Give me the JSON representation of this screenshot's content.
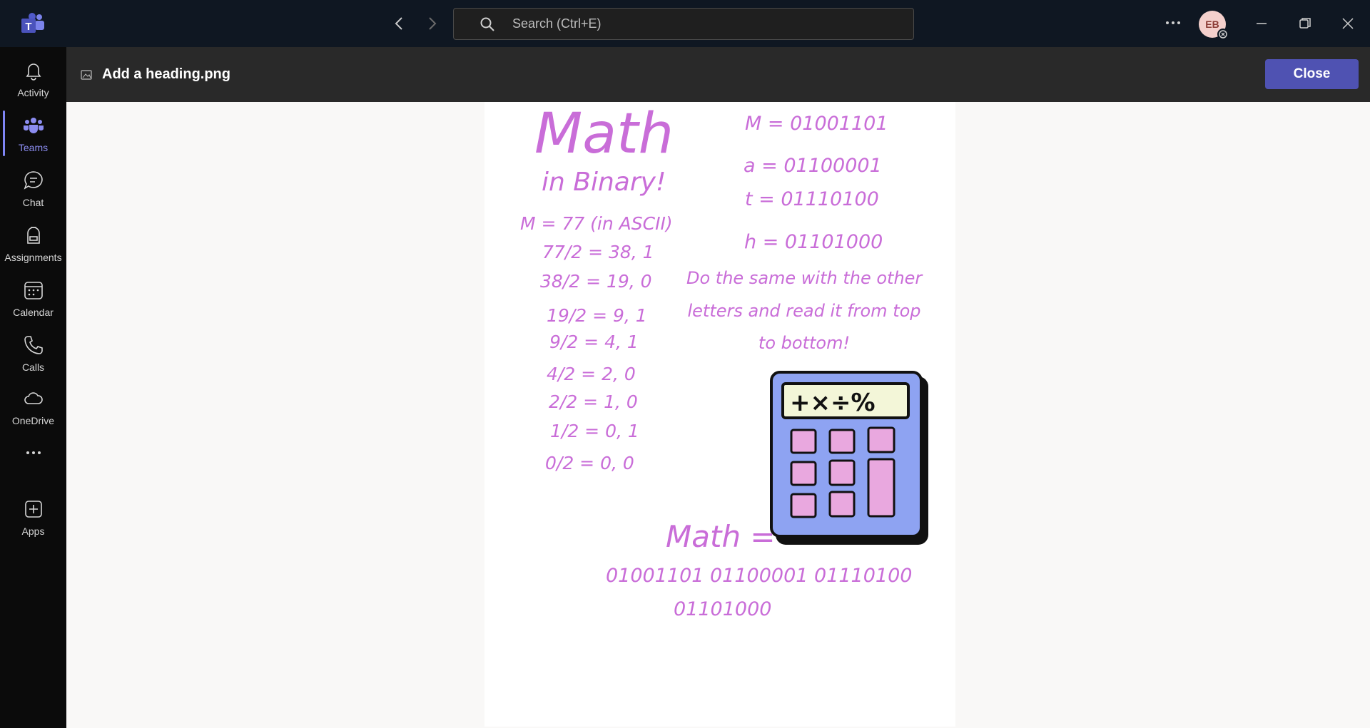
{
  "titlebar": {
    "search_placeholder": "Search (Ctrl+E)",
    "avatar_initials": "EB",
    "icons": [
      "teams-logo-icon",
      "back-arrow-icon",
      "forward-arrow-icon",
      "search-icon",
      "more-options-icon",
      "minimize-icon",
      "restore-icon",
      "close-window-icon"
    ]
  },
  "rail": {
    "items": [
      {
        "label": "Activity",
        "icon": "bell-icon",
        "active": false
      },
      {
        "label": "Teams",
        "icon": "teams-people-icon",
        "active": true
      },
      {
        "label": "Chat",
        "icon": "chat-bubble-icon",
        "active": false
      },
      {
        "label": "Assignments",
        "icon": "backpack-icon",
        "active": false
      },
      {
        "label": "Calendar",
        "icon": "calendar-icon",
        "active": false
      },
      {
        "label": "Calls",
        "icon": "phone-icon",
        "active": false
      },
      {
        "label": "OneDrive",
        "icon": "cloud-icon",
        "active": false
      },
      {
        "label": "",
        "icon": "more-apps-icon",
        "active": false
      },
      {
        "label": "Apps",
        "icon": "add-app-icon",
        "active": false
      }
    ],
    "accent": "#7f85f5"
  },
  "viewer": {
    "file_name": "Add a heading.png",
    "close_label": "Close",
    "close_color": "#4f52b2"
  },
  "image_content": {
    "title": "Math",
    "subtitle": "in Binary!",
    "steps": [
      "M = 77 (in ASCII)",
      "77/2 = 38, 1",
      "38/2 = 19, 0",
      "19/2 = 9, 1",
      "9/2 = 4, 1",
      "4/2 = 2, 0",
      "2/2 = 1, 0",
      "1/2 = 0, 1",
      "0/2 = 0, 0"
    ],
    "letters": [
      "M = 01001101",
      "a = 01100001",
      "t = 01110100",
      "h = 01101000"
    ],
    "note_lines": [
      "Do the same with the other",
      "letters and read it from top",
      "to bottom!"
    ],
    "result_label": "Math =",
    "result_line1": "01001101 01100001 01110100",
    "result_line2": "01101000",
    "calculator_display": "+×÷%",
    "ink_color": "#c96dd8"
  }
}
